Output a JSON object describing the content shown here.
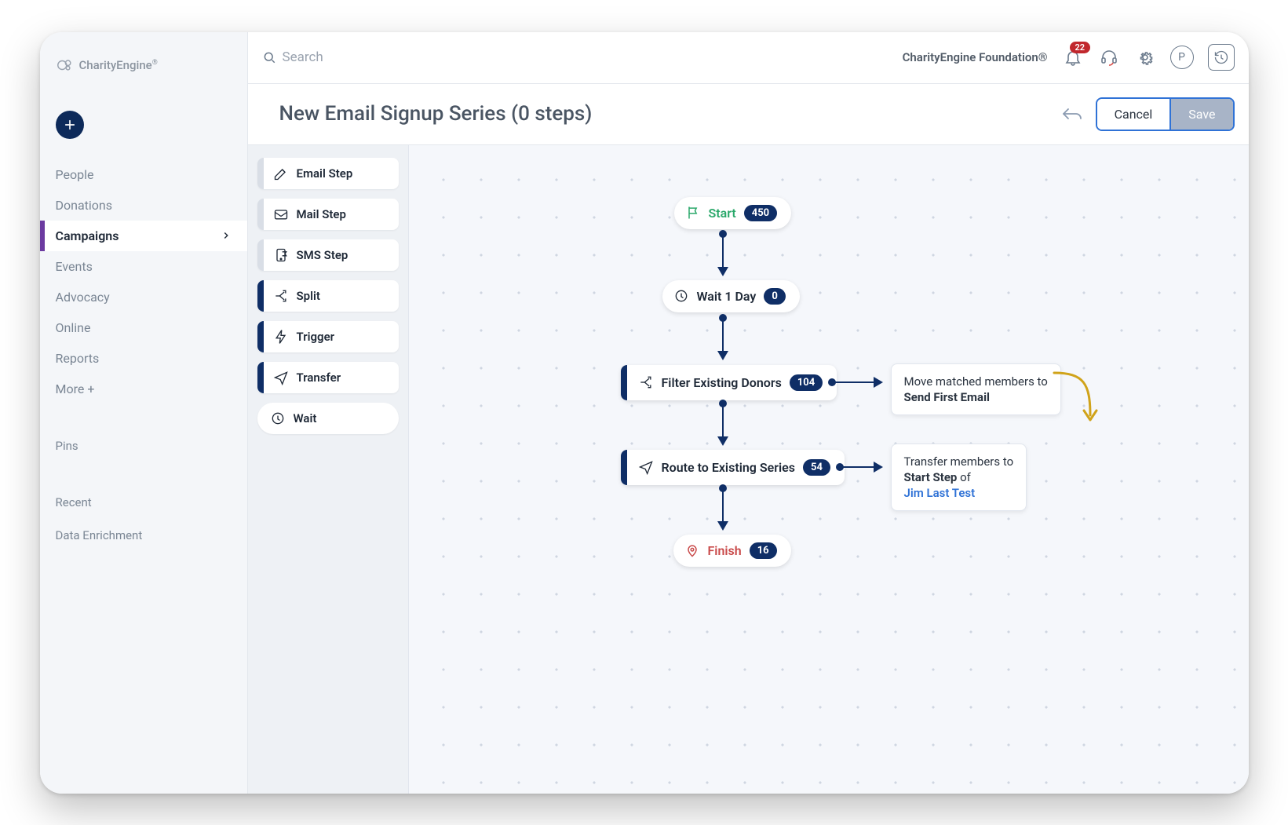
{
  "brand": {
    "name": "CharityEngine",
    "reg": "®"
  },
  "topbar": {
    "search_placeholder": "Search",
    "org_name": "CharityEngine Foundation®",
    "notifications_count": "22",
    "avatar_initial": "P"
  },
  "subbar": {
    "title": "New Email Signup Series (0 steps)",
    "cancel_label": "Cancel",
    "save_label": "Save"
  },
  "sidebar": {
    "add_tooltip": "Add",
    "items": [
      {
        "label": "People"
      },
      {
        "label": "Donations"
      },
      {
        "label": "Campaigns",
        "active": true
      },
      {
        "label": "Events"
      },
      {
        "label": "Advocacy"
      },
      {
        "label": "Online"
      },
      {
        "label": "Reports"
      },
      {
        "label": "More +"
      }
    ],
    "sections": [
      {
        "label": "Pins"
      },
      {
        "label": "Recent"
      },
      {
        "label": "Data Enrichment"
      }
    ]
  },
  "palette": {
    "items": [
      {
        "label": "Email Step",
        "icon": "pen-icon",
        "bar": "light"
      },
      {
        "label": "Mail Step",
        "icon": "mail-icon",
        "bar": "light"
      },
      {
        "label": "SMS Step",
        "icon": "sms-icon",
        "bar": "light"
      },
      {
        "label": "Split",
        "icon": "split-icon",
        "bar": "dark"
      },
      {
        "label": "Trigger",
        "icon": "lightning-icon",
        "bar": "dark"
      },
      {
        "label": "Transfer",
        "icon": "plane-icon",
        "bar": "dark"
      },
      {
        "label": "Wait",
        "icon": "clock-icon",
        "bar": "none"
      }
    ]
  },
  "workflow": {
    "start": {
      "label": "Start",
      "count": "450"
    },
    "wait": {
      "label": "Wait 1 Day",
      "count": "0"
    },
    "filter": {
      "label": "Filter Existing Donors",
      "count": "104"
    },
    "route": {
      "label": "Route to Existing Series",
      "count": "54"
    },
    "finish": {
      "label": "Finish",
      "count": "16"
    },
    "tip_filter_a": "Move matched members to",
    "tip_filter_b": "Send First Email",
    "tip_route_a": "Transfer members to",
    "tip_route_b": "Start Step",
    "tip_route_of": " of",
    "tip_route_link": "Jim Last Test"
  }
}
